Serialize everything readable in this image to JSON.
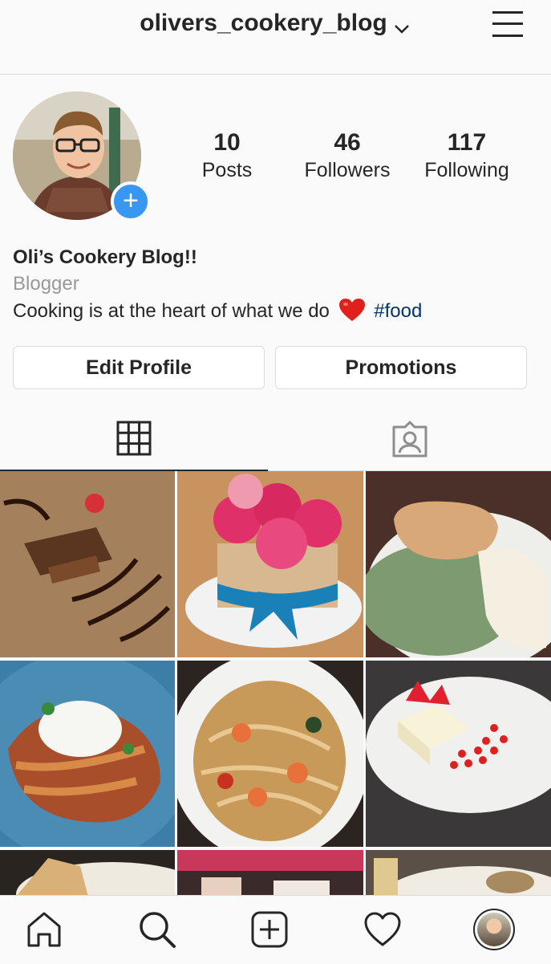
{
  "header": {
    "username": "olivers_cookery_blog",
    "dropdown_icon": "chevron-down-icon",
    "menu_icon": "hamburger-menu-icon"
  },
  "profile": {
    "avatar": "profile-avatar",
    "add_story_icon": "plus-icon",
    "stats": [
      {
        "value": "10",
        "label": "Posts"
      },
      {
        "value": "46",
        "label": "Followers"
      },
      {
        "value": "117",
        "label": "Following"
      }
    ],
    "display_name": "Oli’s Cookery Blog!!",
    "category": "Blogger",
    "bio_text": "Cooking is at the heart of what we do",
    "bio_emoji_icon": "red-heart-icon",
    "bio_hashtag": "#food",
    "edit_profile_label": "Edit Profile",
    "promotions_label": "Promotions"
  },
  "tabs": [
    {
      "icon": "grid-icon",
      "active": true
    },
    {
      "icon": "tagged-person-icon",
      "active": false
    }
  ],
  "grid_posts": [
    "chocolate-dessert-post",
    "rose-cake-post",
    "pie-and-mash-post",
    "pasta-egg-post",
    "prawn-spaghetti-post",
    "panna-cotta-post",
    "bread-post",
    "market-post",
    "plate-post"
  ],
  "bottom_nav": [
    "home-icon",
    "search-icon",
    "add-post-icon",
    "heart-icon",
    "profile-avatar"
  ],
  "colors": {
    "accent_blue": "#3897f0",
    "hashtag": "#003569",
    "heart_red": "#ed4956"
  }
}
